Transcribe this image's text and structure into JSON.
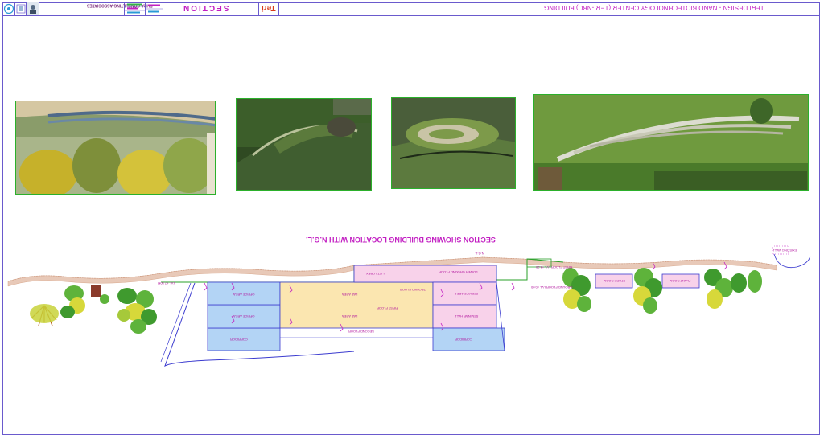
{
  "sheet": {
    "title": "TERI DESIGN - NANO BIOTECHNOLOGY CENTER (TERI-NBC) BUILDING",
    "sheet_name": "SECTION",
    "firm_name": "DHRA CONSULTING ASSOCIATES",
    "logo_text": "Teri"
  },
  "section": {
    "title": "SECTION SHOWING BUILDING LOCATION WITH N.G.L.",
    "labels": {
      "ngl_left": "N.G.L.",
      "ngl_right": "N.G.L.",
      "level_left": "LVL +7.50M",
      "lower_ground": "LOWER GROUND FLOOR",
      "ground_floor": "GROUND FLOOR",
      "first_floor": "FIRST FLOOR",
      "second_floor": "SECOND FLOOR",
      "lab_area": "LAB AREA",
      "office_area": "OFFICE AREA",
      "seminar_hall": "SEMINAR HALL",
      "service_area": "SERVICE AREA",
      "lift_lobby": "LIFT LOBBY",
      "ground_fl_level": "GROUND FLOOR LVL ±0.00",
      "first_fl_level": "FIRST FLOOR LVL +4.20",
      "room_a": "STORE ROOM",
      "room_b": "PLANT ROOM",
      "corridor": "CORRIDOR",
      "existing_wall": "EXISTING WALL"
    }
  },
  "colors": {
    "frame": "#6a5acd",
    "magenta": "#c21fc2",
    "blue_fill": "#b3d4f5",
    "yellow_fill": "#fbe6b0",
    "pink_fill": "#f8d2ea",
    "ground_line": "#2aa02a",
    "earth": "#e8c9b8"
  }
}
